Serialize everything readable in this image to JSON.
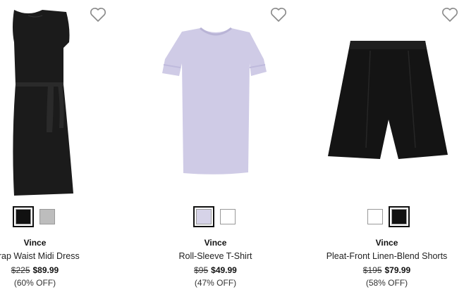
{
  "products": [
    {
      "brand": "Vince",
      "name": "Wrap Waist Midi Dress",
      "original_price": "$225",
      "sale_price": "$89.99",
      "discount": "(60% OFF)",
      "swatches": [
        {
          "color": "#111111",
          "selected": true
        },
        {
          "color": "#bdbdbd",
          "selected": false
        }
      ]
    },
    {
      "brand": "Vince",
      "name": "Roll-Sleeve T-Shirt",
      "original_price": "$95",
      "sale_price": "$49.99",
      "discount": "(47% OFF)",
      "swatches": [
        {
          "color": "#d6d3e8",
          "selected": true
        },
        {
          "color": "#ffffff",
          "selected": false
        }
      ]
    },
    {
      "brand": "Vince",
      "name": "Pleat-Front Linen-Blend Shorts",
      "original_price": "$195",
      "sale_price": "$79.99",
      "discount": "(58% OFF)",
      "swatches": [
        {
          "color": "#ffffff",
          "selected": false
        },
        {
          "color": "#111111",
          "selected": true
        }
      ]
    }
  ],
  "icons": {
    "favorite": "heart-outline-icon"
  },
  "colors": {
    "heart_stroke": "#8a8a8a",
    "dress": "#1b1b1b",
    "tshirt": "#cfcbe6",
    "shorts": "#141414"
  }
}
